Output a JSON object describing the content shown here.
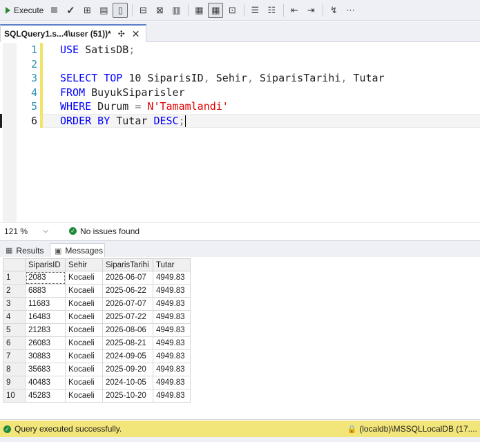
{
  "toolbar": {
    "execute_label": "Execute"
  },
  "tab": {
    "title": "SQLQuery1.s...4\\user (51))*",
    "pin_icon": "pin-icon",
    "close_icon": "close-icon"
  },
  "editor": {
    "line_numbers": [
      "1",
      "2",
      "3",
      "4",
      "5",
      "6"
    ],
    "lines": {
      "l1_kw": "USE",
      "l1_rest": " SatisDB",
      "l1_semi": ";",
      "l4_kw1": "SELECT",
      "l4_kw2": "TOP",
      "l4_num": " 10 ",
      "l4_c1": "SiparisID",
      "l4_c2": " Sehir",
      "l4_c3": " SiparisTarihi",
      "l4_c4": " Tutar",
      "l5_kw": "FROM",
      "l5_rest": " BuyukSiparisler",
      "l6_kw": "WHERE",
      "l6_col": " Durum ",
      "l6_eq": "=",
      "l6_str": " N'Tamamlandi'",
      "l7_kw1": "ORDER",
      "l7_kw2": " BY",
      "l7_col": " Tutar ",
      "l7_kw3": "DESC",
      "l7_semi": ";"
    },
    "comma": ","
  },
  "zoom": {
    "level": "121 %",
    "issues_text": "No issues found"
  },
  "results_tabs": {
    "results_label": "Results",
    "messages_label": "Messages"
  },
  "grid": {
    "headers": [
      "SiparisID",
      "Sehir",
      "SiparisTarihi",
      "Tutar"
    ],
    "rows": [
      [
        "1",
        "2083",
        "Kocaeli",
        "2026-06-07",
        "4949.83"
      ],
      [
        "2",
        "6883",
        "Kocaeli",
        "2025-06-22",
        "4949.83"
      ],
      [
        "3",
        "11683",
        "Kocaeli",
        "2026-07-07",
        "4949.83"
      ],
      [
        "4",
        "16483",
        "Kocaeli",
        "2025-07-22",
        "4949.83"
      ],
      [
        "5",
        "21283",
        "Kocaeli",
        "2026-08-06",
        "4949.83"
      ],
      [
        "6",
        "26083",
        "Kocaeli",
        "2025-08-21",
        "4949.83"
      ],
      [
        "7",
        "30883",
        "Kocaeli",
        "2024-09-05",
        "4949.83"
      ],
      [
        "8",
        "35683",
        "Kocaeli",
        "2025-09-20",
        "4949.83"
      ],
      [
        "9",
        "40483",
        "Kocaeli",
        "2024-10-05",
        "4949.83"
      ],
      [
        "10",
        "45283",
        "Kocaeli",
        "2025-10-20",
        "4949.83"
      ]
    ]
  },
  "status": {
    "message": "Query executed successfully.",
    "connection": "(localdb)\\MSSQLLocalDB (17...."
  },
  "colors": {
    "keyword": "#0000ff",
    "string": "#e00000",
    "line_number": "#2b91af",
    "status_bg": "#f2e57a",
    "success": "#1f8a3a"
  }
}
